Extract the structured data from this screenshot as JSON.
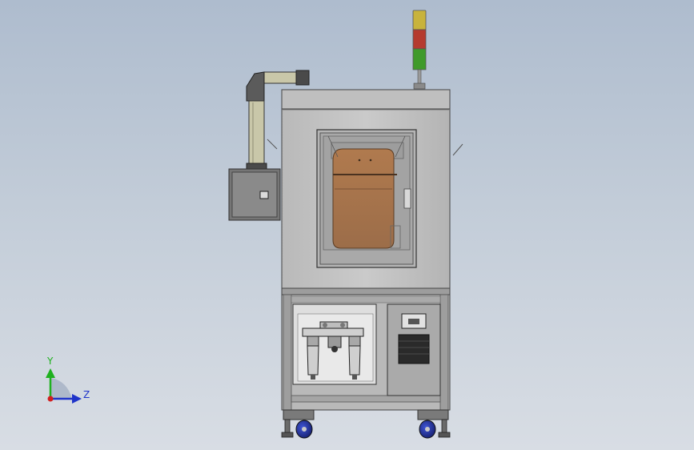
{
  "viewport": {
    "background_top": "#aebcce",
    "background_bottom": "#d8dde4"
  },
  "model": {
    "colors": {
      "body": "#c3c3c3",
      "body_dark": "#8d8d8d",
      "window_tint": "#a5734c",
      "duct": "#c9c7a9",
      "light_yellow": "#c8b33c",
      "light_red": "#b53a2e",
      "light_green": "#3f9a2a",
      "caster": "#25349e"
    }
  },
  "triad": {
    "y_label": "Y",
    "z_label": "Z",
    "y_color": "#1fb11f",
    "z_color": "#1f34c9",
    "origin_color": "#d21f1f"
  }
}
